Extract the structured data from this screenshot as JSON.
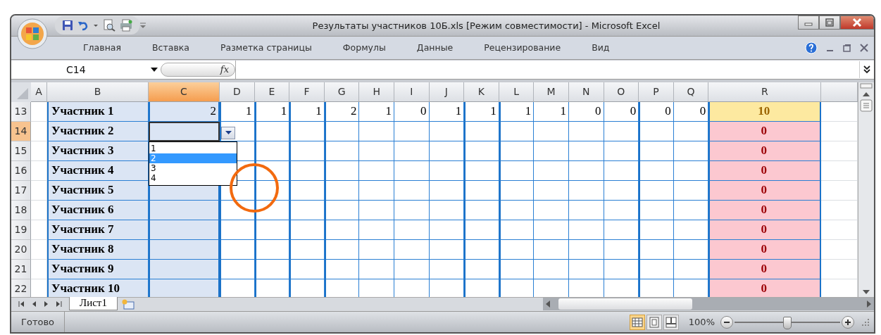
{
  "window": {
    "title": "Результаты участников 10Б.xls  [Режим совместимости] - Microsoft Excel"
  },
  "ribbon_tabs": [
    "Главная",
    "Вставка",
    "Разметка страницы",
    "Формулы",
    "Данные",
    "Рецензирование",
    "Вид"
  ],
  "formula_bar": {
    "name_box": "C14",
    "function_label": "fx"
  },
  "columns": [
    {
      "label": "A",
      "selected": false
    },
    {
      "label": "B",
      "selected": false
    },
    {
      "label": "C",
      "selected": true
    },
    {
      "label": "D",
      "selected": false
    },
    {
      "label": "E",
      "selected": false
    },
    {
      "label": "F",
      "selected": false
    },
    {
      "label": "G",
      "selected": false
    },
    {
      "label": "H",
      "selected": false
    },
    {
      "label": "I",
      "selected": false
    },
    {
      "label": "J",
      "selected": false
    },
    {
      "label": "K",
      "selected": false
    },
    {
      "label": "L",
      "selected": false
    },
    {
      "label": "M",
      "selected": false
    },
    {
      "label": "N",
      "selected": false
    },
    {
      "label": "O",
      "selected": false
    },
    {
      "label": "P",
      "selected": false
    },
    {
      "label": "Q",
      "selected": false
    },
    {
      "label": "R",
      "selected": false
    }
  ],
  "rows": [
    {
      "number": "13",
      "selected": false,
      "name": "Участник 1",
      "cells": [
        "2",
        "1",
        "1",
        "1",
        "2",
        "1",
        "0",
        "1",
        "1",
        "1",
        "1",
        "0",
        "0",
        "0",
        "0"
      ],
      "total": {
        "value": "10",
        "kind": "complete"
      }
    },
    {
      "number": "14",
      "selected": true,
      "name": "Участник 2",
      "total": {
        "value": "0",
        "kind": "empty"
      }
    },
    {
      "number": "15",
      "selected": false,
      "name": "Участник 3",
      "total": {
        "value": "0",
        "kind": "empty"
      }
    },
    {
      "number": "16",
      "selected": false,
      "name": "Участник 4",
      "total": {
        "value": "0",
        "kind": "empty"
      }
    },
    {
      "number": "17",
      "selected": false,
      "name": "Участник 5",
      "total": {
        "value": "0",
        "kind": "empty"
      }
    },
    {
      "number": "18",
      "selected": false,
      "name": "Участник 6",
      "total": {
        "value": "0",
        "kind": "empty"
      }
    },
    {
      "number": "19",
      "selected": false,
      "name": "Участник 7",
      "total": {
        "value": "0",
        "kind": "empty"
      }
    },
    {
      "number": "20",
      "selected": false,
      "name": "Участник 8",
      "total": {
        "value": "0",
        "kind": "empty"
      }
    },
    {
      "number": "21",
      "selected": false,
      "name": "Участник 9",
      "total": {
        "value": "0",
        "kind": "empty"
      }
    },
    {
      "number": "22",
      "selected": false,
      "name": "Участник 10",
      "total": {
        "value": "0",
        "kind": "empty"
      }
    }
  ],
  "dropdown": {
    "options": [
      {
        "label": "1",
        "selected": false
      },
      {
        "label": "2",
        "selected": true
      },
      {
        "label": "3",
        "selected": false
      },
      {
        "label": "4",
        "selected": false
      }
    ]
  },
  "sheet_tabs": [
    {
      "label": "Лист1",
      "selected": true
    }
  ],
  "status_bar": {
    "text": "Готово",
    "views": [
      {
        "kind": "normal",
        "selected": true
      },
      {
        "kind": "page-layout",
        "selected": false
      },
      {
        "kind": "page-break",
        "selected": false
      }
    ],
    "zoom": "100%",
    "zoom_slider": {
      "level": 0.5
    }
  }
}
